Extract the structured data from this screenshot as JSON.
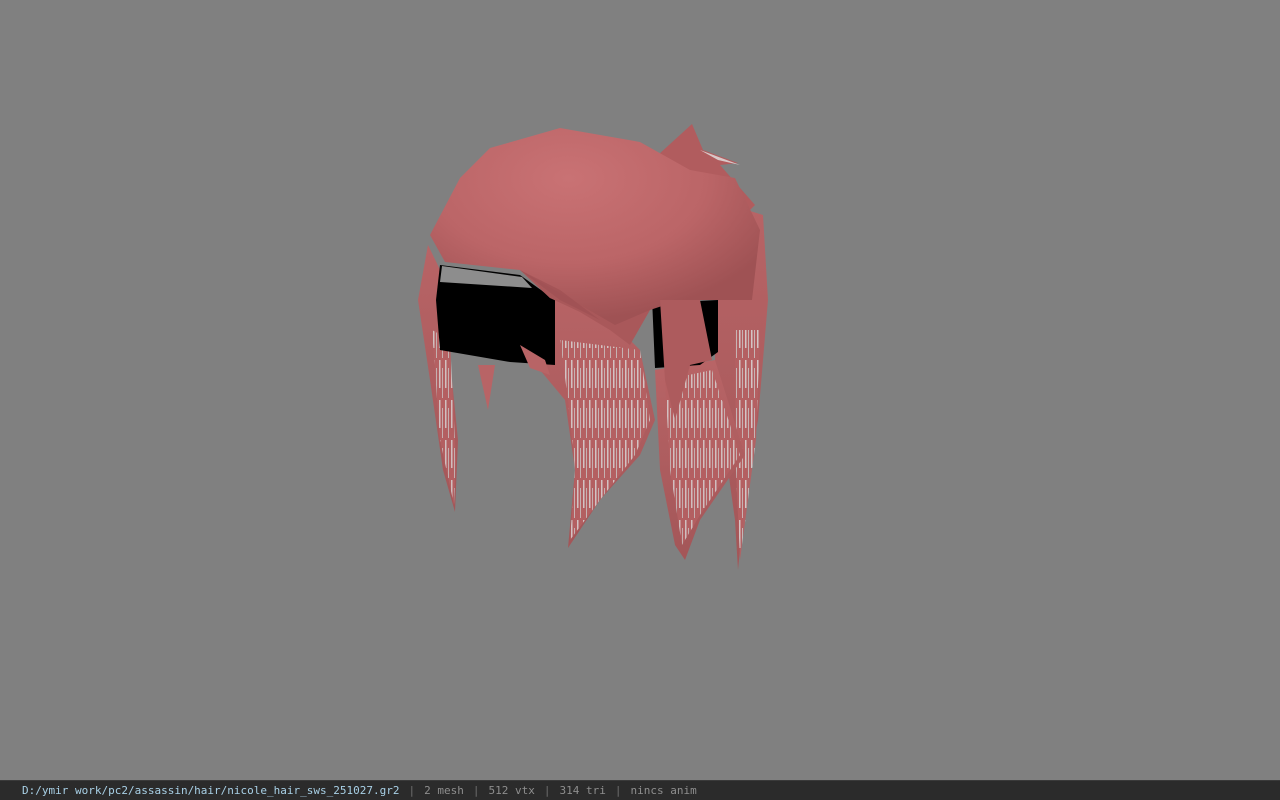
{
  "viewport": {
    "background": "#808080",
    "model": {
      "hair_color": "#c87172",
      "hair_shadow": "#a85a5c",
      "band_color": "#000000",
      "streak_color": "#d9d2d2"
    }
  },
  "statusbar": {
    "file_path": "D:/ymir work/pc2/assassin/hair/nicole_hair_sws_251027.gr2",
    "mesh_count": "2 mesh",
    "vertex_count": "512 vtx",
    "triangle_count": "314 tri",
    "anim_status": "nincs anim",
    "separator": "|"
  }
}
